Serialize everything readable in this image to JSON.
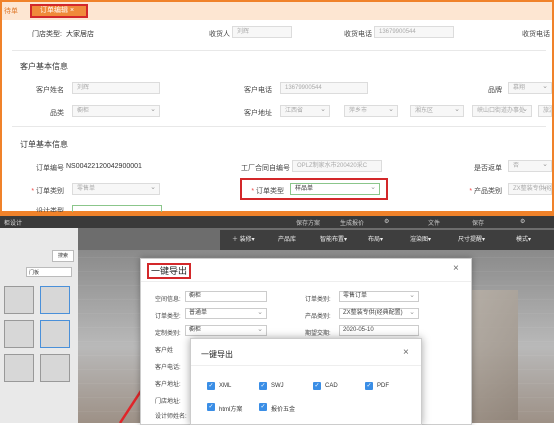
{
  "tabs": {
    "prev": "待单",
    "active": "订单编辑"
  },
  "store": {
    "label": "门店类型:",
    "value": "大家居店",
    "receiver_label": "收货人",
    "receiver_value": "刘辉",
    "phone_label": "收货电话",
    "phone_value": "13679900544",
    "phone2_label": "收货电话"
  },
  "customer": {
    "section": "客户基本信息",
    "name_label": "客户姓名",
    "name_value": "刘辉",
    "phone_label": "客户电话",
    "phone_value": "13679900544",
    "brand_label": "品牌",
    "brand_value": "慕翔",
    "category_label": "品类",
    "category_value": "橱柜",
    "address_label": "客户地址",
    "addr_province": "江西省",
    "addr_city": "萍乡市",
    "addr_district": "湘东区",
    "addr_detail": "峡山口街道办事处",
    "addr_extra": "旅游"
  },
  "order": {
    "section": "订单基本信息",
    "no_label": "订单编号",
    "no_value": "NS00422120042900001",
    "contract_label": "工厂合同自编号",
    "contract_value": "OPLZ制家水市200420采C",
    "resale_label": "是否返单",
    "resale_value": "否",
    "cat_label": "订单类别",
    "cat_value": "零售单",
    "type_label": "订单类型",
    "type_value": "样品单",
    "product_label": "产品类别",
    "product_value": "ZX整装专供(经典",
    "design_label": "设计类型"
  },
  "design": {
    "bar_left": "柜设计",
    "bar_items": [
      "保存方案",
      "生成报价",
      "⚙"
    ],
    "bar_right": [
      "文件",
      "保存",
      "⚙"
    ],
    "tools": [
      "＋ 装修▾",
      "产品库",
      "智能布置▾",
      "布局▾",
      "渲染图▾",
      "尺寸提醒▾",
      "模式▾"
    ],
    "search": "搜索",
    "left_filter": "门板"
  },
  "export1": {
    "title": "一键导出",
    "close": "×",
    "space_label": "空间信息:",
    "space_value": "橱柜",
    "cat_label": "订单类别:",
    "cat_value": "零售订单",
    "type_label": "订单类型:",
    "type_value": "普通单",
    "product_label": "产品类别:",
    "product_value": "ZX整装专供(经典配置)",
    "custom_label": "定制类别:",
    "custom_value": "橱柜",
    "date_label": "期望交期:",
    "date_value": "2020-05-10",
    "customer_label": "客户姓",
    "phone_label": "客户电话:",
    "addr_label": "客户地址:",
    "store_label": "门店地址:",
    "designer_label": "设计师姓名:"
  },
  "export2": {
    "title": "一键导出",
    "close": "×",
    "options": [
      "XML",
      "SWJ",
      "CAD",
      "PDF",
      "html方案",
      "报价五金"
    ]
  },
  "colors": {
    "accent": "#f0822a",
    "highlight": "#d3282a",
    "check": "#3a8ee6"
  }
}
